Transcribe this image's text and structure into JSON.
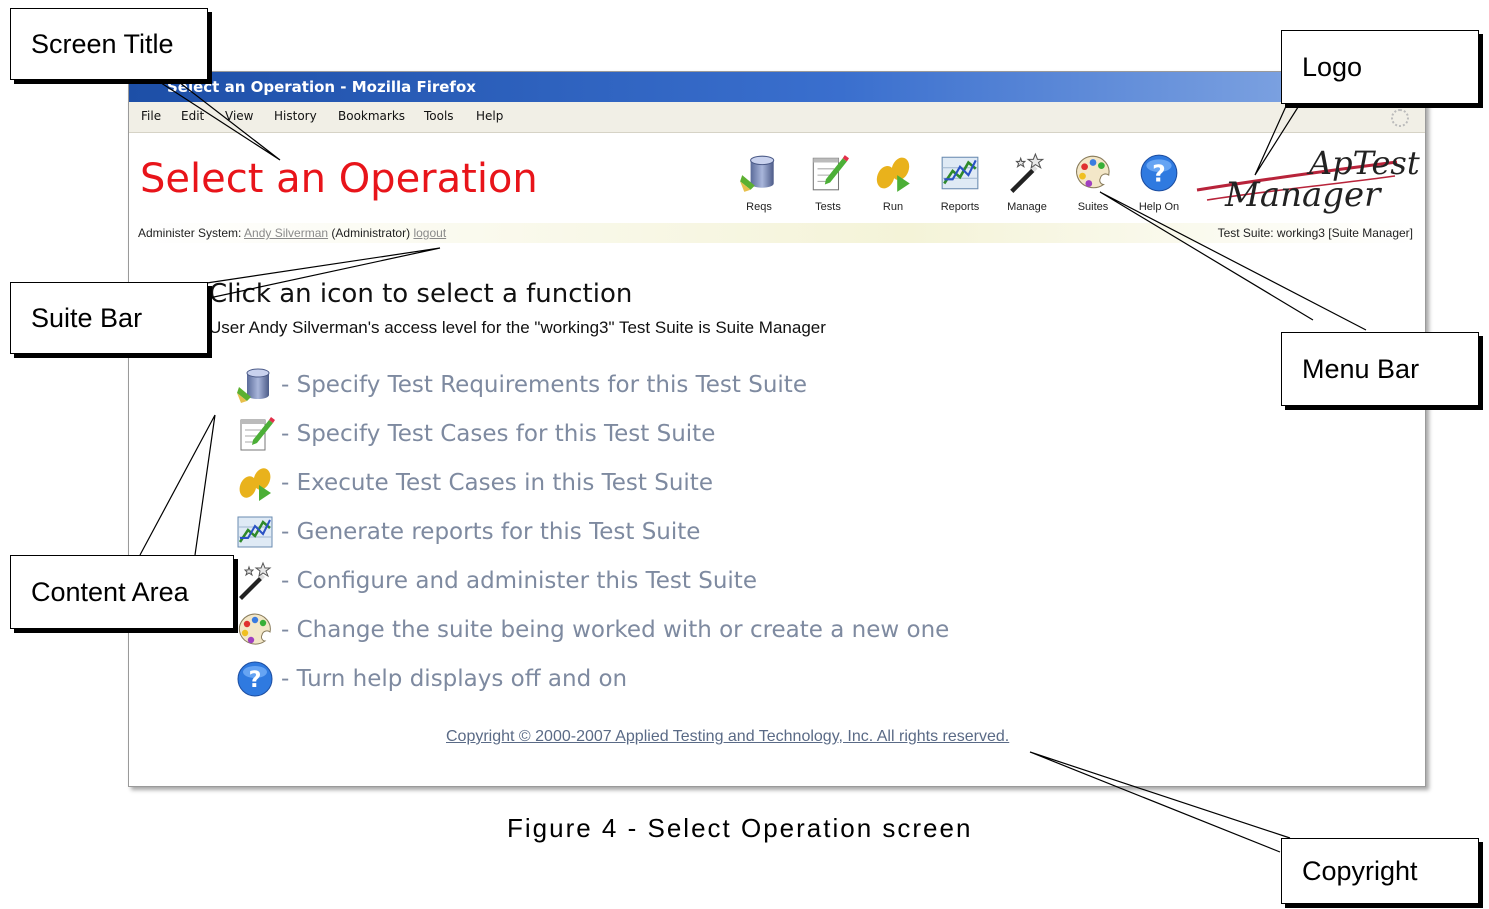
{
  "browser": {
    "window_title": "Select an Operation - Mozilla Firefox",
    "menu": [
      "File",
      "Edit",
      "View",
      "History",
      "Bookmarks",
      "Tools",
      "Help"
    ]
  },
  "app": {
    "page_title": "Select an Operation",
    "toolbar": [
      {
        "label": "Reqs",
        "icon": "database-icon"
      },
      {
        "label": "Tests",
        "icon": "notepad-icon"
      },
      {
        "label": "Run",
        "icon": "footprints-icon"
      },
      {
        "label": "Reports",
        "icon": "chart-icon"
      },
      {
        "label": "Manage",
        "icon": "magic-wand-icon"
      },
      {
        "label": "Suites",
        "icon": "palette-icon"
      },
      {
        "label": "Help On",
        "icon": "help-icon"
      }
    ],
    "logo_text": [
      "ApTest",
      "Manager"
    ],
    "suite_bar": {
      "prefix": "Administer System:",
      "user_link": "Andy Silverman",
      "role": "(Administrator)",
      "logout": "logout",
      "suite_info": "Test Suite: working3 [Suite Manager]"
    },
    "content": {
      "heading": "Click an icon to select a function",
      "subheading": "User Andy Silverman's access level for the \"working3\" Test Suite is Suite Manager",
      "functions": [
        {
          "icon": "database-icon",
          "text": "- Specify Test Requirements for this Test Suite"
        },
        {
          "icon": "notepad-icon",
          "text": "- Specify Test Cases for this Test Suite"
        },
        {
          "icon": "footprints-icon",
          "text": "- Execute Test Cases in this Test Suite"
        },
        {
          "icon": "chart-icon",
          "text": "- Generate reports for this Test Suite"
        },
        {
          "icon": "magic-wand-icon",
          "text": "- Configure and administer this Test Suite"
        },
        {
          "icon": "palette-icon",
          "text": "- Change the suite being worked with or create a new one"
        },
        {
          "icon": "help-icon",
          "text": "- Turn help displays off and on"
        }
      ],
      "copyright": "Copyright © 2000-2007 Applied Testing and Technology, Inc. All rights reserved."
    }
  },
  "callouts": {
    "screen_title": "Screen Title",
    "logo": "Logo",
    "suite_bar": "Suite Bar",
    "menu_bar": "Menu Bar",
    "content_area": "Content Area",
    "copyright": "Copyright"
  },
  "caption": "Figure 4 - Select Operation screen",
  "colors": {
    "title_red": "#e8141a",
    "link_gray": "#7e8aa0",
    "titlebar_blue": "#1d4fa7"
  }
}
